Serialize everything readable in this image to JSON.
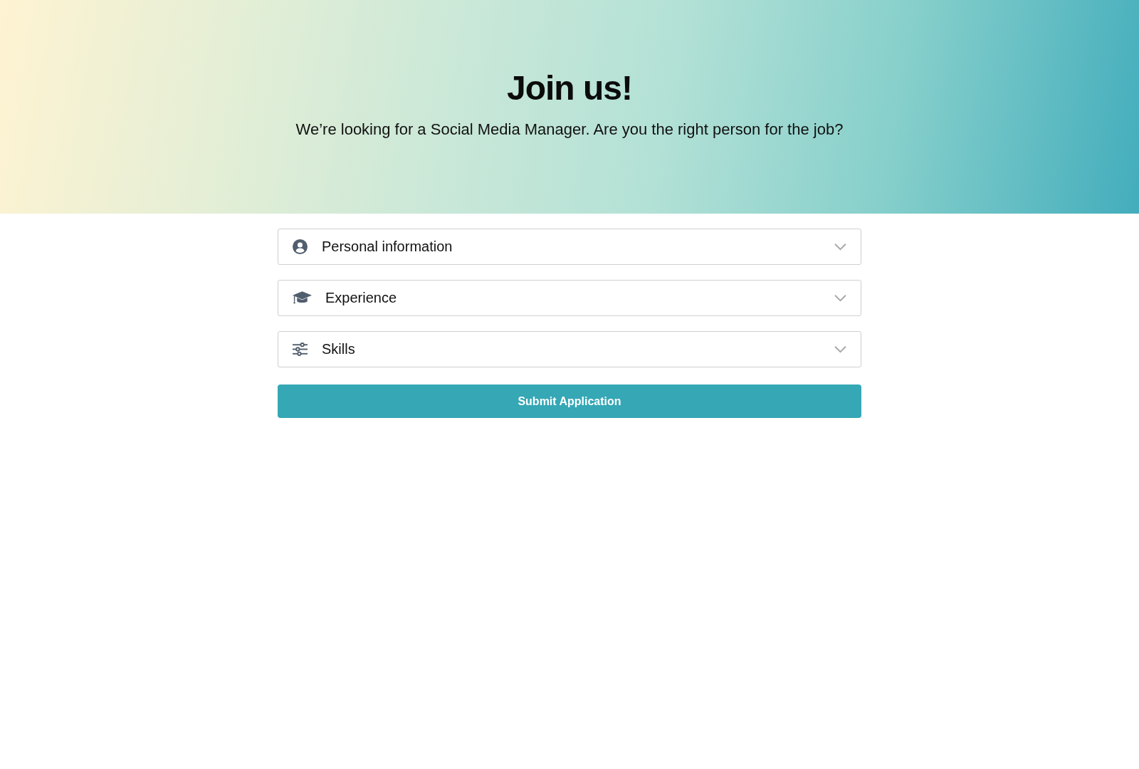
{
  "header": {
    "title": "Join us!",
    "subtitle": "We’re looking for a Social Media Manager. Are you the right person for the job?"
  },
  "sections": [
    {
      "label": "Personal information",
      "expanded": false
    },
    {
      "label": "Experience",
      "expanded": false
    },
    {
      "label": "Skills",
      "expanded": false
    }
  ],
  "submit_button": "Submit Application"
}
